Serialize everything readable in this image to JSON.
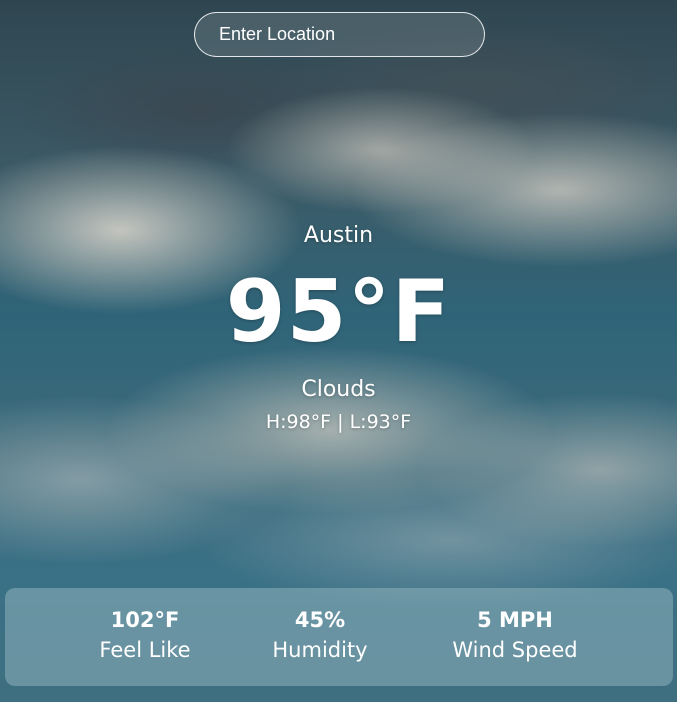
{
  "search": {
    "placeholder": "Enter Location",
    "value": ""
  },
  "current": {
    "city": "Austin",
    "temperature": "95°F",
    "condition": "Clouds",
    "high_low": "H:98°F | L:93°F"
  },
  "stats": [
    {
      "value": "102°F",
      "label": "Feel Like"
    },
    {
      "value": "45%",
      "label": "Humidity"
    },
    {
      "value": "5 MPH",
      "label": "Wind Speed"
    }
  ]
}
